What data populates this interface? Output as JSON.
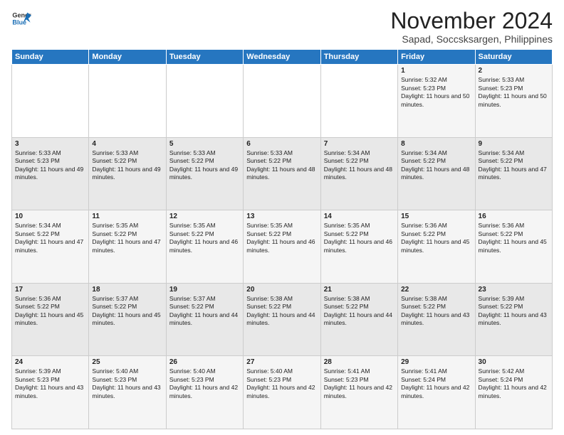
{
  "logo": {
    "line1": "General",
    "line2": "Blue"
  },
  "title": "November 2024",
  "subtitle": "Sapad, Soccsksargen, Philippines",
  "days_header": [
    "Sunday",
    "Monday",
    "Tuesday",
    "Wednesday",
    "Thursday",
    "Friday",
    "Saturday"
  ],
  "weeks": [
    [
      {
        "day": "",
        "info": ""
      },
      {
        "day": "",
        "info": ""
      },
      {
        "day": "",
        "info": ""
      },
      {
        "day": "",
        "info": ""
      },
      {
        "day": "",
        "info": ""
      },
      {
        "day": "1",
        "info": "Sunrise: 5:32 AM\nSunset: 5:23 PM\nDaylight: 11 hours and 50 minutes."
      },
      {
        "day": "2",
        "info": "Sunrise: 5:33 AM\nSunset: 5:23 PM\nDaylight: 11 hours and 50 minutes."
      }
    ],
    [
      {
        "day": "3",
        "info": "Sunrise: 5:33 AM\nSunset: 5:23 PM\nDaylight: 11 hours and 49 minutes."
      },
      {
        "day": "4",
        "info": "Sunrise: 5:33 AM\nSunset: 5:22 PM\nDaylight: 11 hours and 49 minutes."
      },
      {
        "day": "5",
        "info": "Sunrise: 5:33 AM\nSunset: 5:22 PM\nDaylight: 11 hours and 49 minutes."
      },
      {
        "day": "6",
        "info": "Sunrise: 5:33 AM\nSunset: 5:22 PM\nDaylight: 11 hours and 48 minutes."
      },
      {
        "day": "7",
        "info": "Sunrise: 5:34 AM\nSunset: 5:22 PM\nDaylight: 11 hours and 48 minutes."
      },
      {
        "day": "8",
        "info": "Sunrise: 5:34 AM\nSunset: 5:22 PM\nDaylight: 11 hours and 48 minutes."
      },
      {
        "day": "9",
        "info": "Sunrise: 5:34 AM\nSunset: 5:22 PM\nDaylight: 11 hours and 47 minutes."
      }
    ],
    [
      {
        "day": "10",
        "info": "Sunrise: 5:34 AM\nSunset: 5:22 PM\nDaylight: 11 hours and 47 minutes."
      },
      {
        "day": "11",
        "info": "Sunrise: 5:35 AM\nSunset: 5:22 PM\nDaylight: 11 hours and 47 minutes."
      },
      {
        "day": "12",
        "info": "Sunrise: 5:35 AM\nSunset: 5:22 PM\nDaylight: 11 hours and 46 minutes."
      },
      {
        "day": "13",
        "info": "Sunrise: 5:35 AM\nSunset: 5:22 PM\nDaylight: 11 hours and 46 minutes."
      },
      {
        "day": "14",
        "info": "Sunrise: 5:35 AM\nSunset: 5:22 PM\nDaylight: 11 hours and 46 minutes."
      },
      {
        "day": "15",
        "info": "Sunrise: 5:36 AM\nSunset: 5:22 PM\nDaylight: 11 hours and 45 minutes."
      },
      {
        "day": "16",
        "info": "Sunrise: 5:36 AM\nSunset: 5:22 PM\nDaylight: 11 hours and 45 minutes."
      }
    ],
    [
      {
        "day": "17",
        "info": "Sunrise: 5:36 AM\nSunset: 5:22 PM\nDaylight: 11 hours and 45 minutes."
      },
      {
        "day": "18",
        "info": "Sunrise: 5:37 AM\nSunset: 5:22 PM\nDaylight: 11 hours and 45 minutes."
      },
      {
        "day": "19",
        "info": "Sunrise: 5:37 AM\nSunset: 5:22 PM\nDaylight: 11 hours and 44 minutes."
      },
      {
        "day": "20",
        "info": "Sunrise: 5:38 AM\nSunset: 5:22 PM\nDaylight: 11 hours and 44 minutes."
      },
      {
        "day": "21",
        "info": "Sunrise: 5:38 AM\nSunset: 5:22 PM\nDaylight: 11 hours and 44 minutes."
      },
      {
        "day": "22",
        "info": "Sunrise: 5:38 AM\nSunset: 5:22 PM\nDaylight: 11 hours and 43 minutes."
      },
      {
        "day": "23",
        "info": "Sunrise: 5:39 AM\nSunset: 5:22 PM\nDaylight: 11 hours and 43 minutes."
      }
    ],
    [
      {
        "day": "24",
        "info": "Sunrise: 5:39 AM\nSunset: 5:23 PM\nDaylight: 11 hours and 43 minutes."
      },
      {
        "day": "25",
        "info": "Sunrise: 5:40 AM\nSunset: 5:23 PM\nDaylight: 11 hours and 43 minutes."
      },
      {
        "day": "26",
        "info": "Sunrise: 5:40 AM\nSunset: 5:23 PM\nDaylight: 11 hours and 42 minutes."
      },
      {
        "day": "27",
        "info": "Sunrise: 5:40 AM\nSunset: 5:23 PM\nDaylight: 11 hours and 42 minutes."
      },
      {
        "day": "28",
        "info": "Sunrise: 5:41 AM\nSunset: 5:23 PM\nDaylight: 11 hours and 42 minutes."
      },
      {
        "day": "29",
        "info": "Sunrise: 5:41 AM\nSunset: 5:24 PM\nDaylight: 11 hours and 42 minutes."
      },
      {
        "day": "30",
        "info": "Sunrise: 5:42 AM\nSunset: 5:24 PM\nDaylight: 11 hours and 42 minutes."
      }
    ]
  ]
}
